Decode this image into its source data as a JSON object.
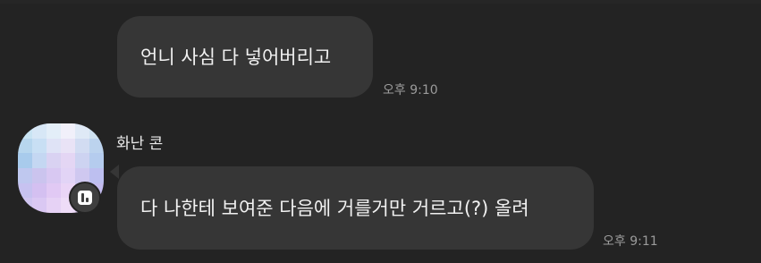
{
  "messages": [
    {
      "text": "언니 사심 다 넣어버리고",
      "time": "오후 9:10"
    },
    {
      "sender": "화난 콘",
      "text": "다 나한테 보여준 다음에 거를거만 거르고(?) 올려",
      "time": "오후 9:11"
    }
  ],
  "avatar": {
    "icon": "blurred-profile-photo",
    "badge_icon": "app-badge-icon"
  },
  "colors": {
    "background": "#232323",
    "bubble": "#363636",
    "time": "#9b9b9b"
  }
}
